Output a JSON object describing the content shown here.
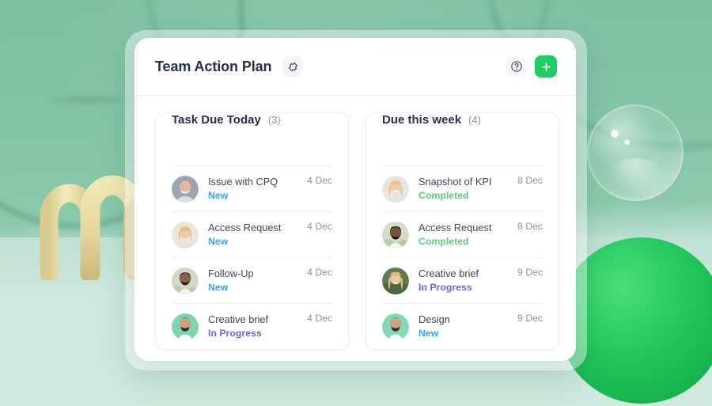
{
  "app": {
    "title": "Team Action Plan",
    "pin_icon": "pushpin-icon",
    "help_icon": "question-circle-icon",
    "add_icon": "plus-icon"
  },
  "colors": {
    "accent_green": "#1fce61",
    "status_new": "#38a5f5",
    "status_completed": "#5bcb7d",
    "status_in_progress": "#6c63f5",
    "title": "#27314a",
    "muted": "#8b93a7"
  },
  "cards": [
    {
      "title": "Task Due Today",
      "count": "(3)",
      "rows": [
        {
          "name": "Issue with CPQ",
          "status": "New",
          "status_class": "st-new",
          "date": "4 Dec",
          "avatar": "avatar-man-smiling"
        },
        {
          "name": "Access Request",
          "status": "New",
          "status_class": "st-new",
          "date": "4 Dec",
          "avatar": "avatar-blonde-woman"
        },
        {
          "name": "Follow-Up",
          "status": "New",
          "status_class": "st-new",
          "date": "4 Dec",
          "avatar": "avatar-man-beard-outdoors"
        },
        {
          "name": "Creative brief",
          "status": "In Progress",
          "status_class": "st-inprogress",
          "date": "4 Dec",
          "avatar": "avatar-man-beard-green-bg"
        }
      ]
    },
    {
      "title": "Due this week",
      "count": "(4)",
      "rows": [
        {
          "name": "Snapshot of KPI",
          "status": "Completed",
          "status_class": "st-completed",
          "date": "8 Dec",
          "avatar": "avatar-woman-blonde-smiling"
        },
        {
          "name": "Access Request",
          "status": "Completed",
          "status_class": "st-completed",
          "date": "8 Dec",
          "avatar": "avatar-man-dark-hair"
        },
        {
          "name": "Creative brief",
          "status": "In Progress",
          "status_class": "st-inprogress",
          "date": "9 Dec",
          "avatar": "avatar-woman-long-blonde"
        },
        {
          "name": "Design",
          "status": "New",
          "status_class": "st-new",
          "date": "9 Dec",
          "avatar": "avatar-man-beard-green-bg-2"
        }
      ]
    }
  ]
}
